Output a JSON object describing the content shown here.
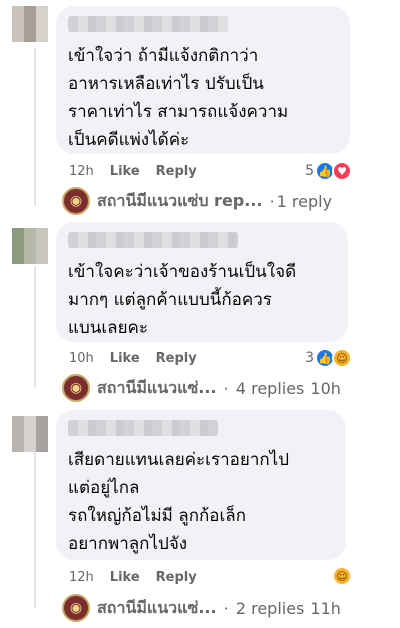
{
  "comments": [
    {
      "text": "เข้าใจว่า ถ้ามีแจ้งกติกาว่า\nอาหารเหลือเท่าไร ปรับเป็น\nราคาเท่าไร สามารถแจ้งความ\nเป็นคดีแพ่งได้ค่ะ",
      "time": "12h",
      "like_label": "Like",
      "reply_label": "Reply",
      "reaction_count": "5",
      "reaction_icons": [
        "like",
        "love"
      ],
      "replies_summary": {
        "name": "สถานีมีแนวแซ่บ rep...",
        "count_text": "1 reply",
        "time": ""
      }
    },
    {
      "text": "เข้าใจคะว่าเจ้าของร้านเป็นใจดี\nมากๆ แต่ลูกค้าแบบนี้ก้อควร\nแบนเลยคะ",
      "time": "10h",
      "like_label": "Like",
      "reply_label": "Reply",
      "reaction_count": "3",
      "reaction_icons": [
        "like",
        "care"
      ],
      "replies_summary": {
        "name": "สถานีมีแนวแซ่...",
        "count_text": "4 replies",
        "time": "10h"
      }
    },
    {
      "text": "เสียดายแทนเลยค่ะเราอยากไป\nแต่อยู่ไกล\nรถใหญ่ก้อไม่มี ลูกก้อเล็ก\nอยากพาลูกไปจัง",
      "time": "12h",
      "like_label": "Like",
      "reply_label": "Reply",
      "reaction_count": "",
      "reaction_icons": [
        "care"
      ],
      "replies_summary": {
        "name": "สถานีมีแนวแซ่...",
        "count_text": "2 replies",
        "time": "11h"
      }
    }
  ],
  "icons": {
    "reply_arrow": "reply-arrow-icon"
  },
  "colors": {
    "bubble": "#f0f2f5",
    "like": "#1877f2",
    "love": "#f33e58",
    "care": "#f7b125",
    "meta": "#65676b"
  }
}
